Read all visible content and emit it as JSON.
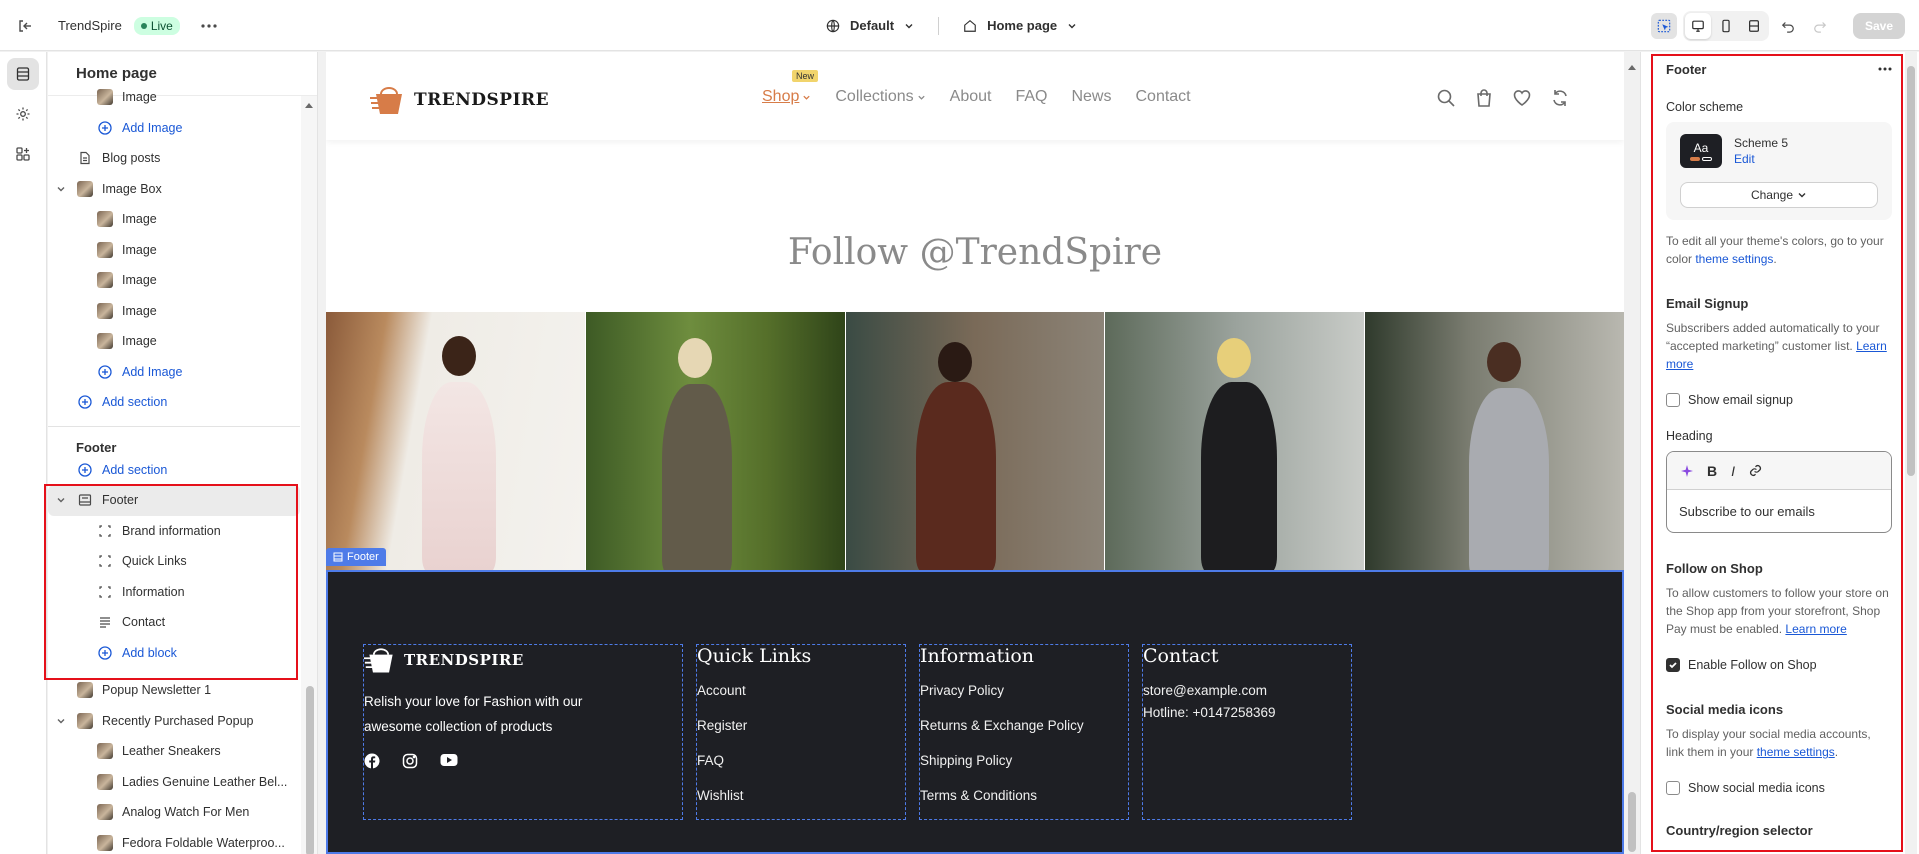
{
  "topbar": {
    "store_name": "TrendSpire",
    "status": "Live",
    "theme": "Default",
    "page": "Home page",
    "save": "Save"
  },
  "sidebar": {
    "title": "Home page",
    "rows_top": [
      {
        "label": "Image",
        "kind": "child"
      },
      {
        "label": "Add Image",
        "kind": "add-child"
      },
      {
        "label": "Blog posts",
        "kind": "section"
      },
      {
        "label": "Image Box",
        "kind": "section-open"
      },
      {
        "label": "Image",
        "kind": "child"
      },
      {
        "label": "Image",
        "kind": "child"
      },
      {
        "label": "Image",
        "kind": "child"
      },
      {
        "label": "Image",
        "kind": "child"
      },
      {
        "label": "Image",
        "kind": "child"
      },
      {
        "label": "Add Image",
        "kind": "add-child"
      },
      {
        "label": "Add section",
        "kind": "add"
      }
    ],
    "footer_group": "Footer",
    "footer_add_section": "Add section",
    "footer_section": "Footer",
    "footer_blocks": [
      "Brand information",
      "Quick Links",
      "Information",
      "Contact"
    ],
    "add_block": "Add block",
    "rows_bottom": [
      {
        "label": "Popup Newsletter 1",
        "kind": "section"
      },
      {
        "label": "Recently Purchased Popup",
        "kind": "section-open"
      },
      {
        "label": "Leather Sneakers",
        "kind": "child"
      },
      {
        "label": "Ladies Genuine Leather Bel...",
        "kind": "child"
      },
      {
        "label": "Analog Watch For Men",
        "kind": "child"
      },
      {
        "label": "Fedora Foldable Waterproo...",
        "kind": "child"
      }
    ]
  },
  "preview": {
    "logo": "TRENDSPIRE",
    "nav": [
      "Shop",
      "Collections",
      "About",
      "FAQ",
      "News",
      "Contact"
    ],
    "new_badge": "New",
    "follow_title": "Follow @TrendSpire",
    "footer_tag": "Footer",
    "brand_text": "Relish your love for Fashion with our awesome collection of products",
    "quick_links": {
      "title": "Quick Links",
      "items": [
        "Account",
        "Register",
        "FAQ",
        "Wishlist"
      ]
    },
    "information": {
      "title": "Information",
      "items": [
        "Privacy Policy",
        "Returns & Exchange Policy",
        "Shipping Policy",
        "Terms & Conditions"
      ]
    },
    "contact": {
      "title": "Contact",
      "email": "store@example.com",
      "hotline": "Hotline: +0147258369"
    }
  },
  "panel": {
    "title": "Footer",
    "color_scheme_label": "Color scheme",
    "scheme_name": "Scheme 5",
    "scheme_edit": "Edit",
    "scheme_swatch": "Aa",
    "change": "Change",
    "color_help_pre": "To edit all your theme's colors, go to your color ",
    "color_help_link": "theme settings",
    "color_help_post": ".",
    "email_title": "Email Signup",
    "email_help": "Subscribers added automatically to your “accepted marketing” customer list. ",
    "learn_more": "Learn more",
    "show_email": "Show email signup",
    "heading_label": "Heading",
    "heading_value": "Subscribe to our emails",
    "follow_title": "Follow on Shop",
    "follow_help": "To allow customers to follow your store on the Shop app from your storefront, Shop Pay must be enabled. ",
    "enable_follow": "Enable Follow on Shop",
    "social_title": "Social media icons",
    "social_help_pre": "To display your social media accounts, link them in your ",
    "social_help_link": "theme settings",
    "social_help_post": ".",
    "show_social": "Show social media icons",
    "country_title": "Country/region selector"
  },
  "colors": {
    "accent": "#1a58d6",
    "highlight": "#e5101a",
    "footer_bg": "#1e1f24",
    "shop_nav": "#d77c48"
  }
}
